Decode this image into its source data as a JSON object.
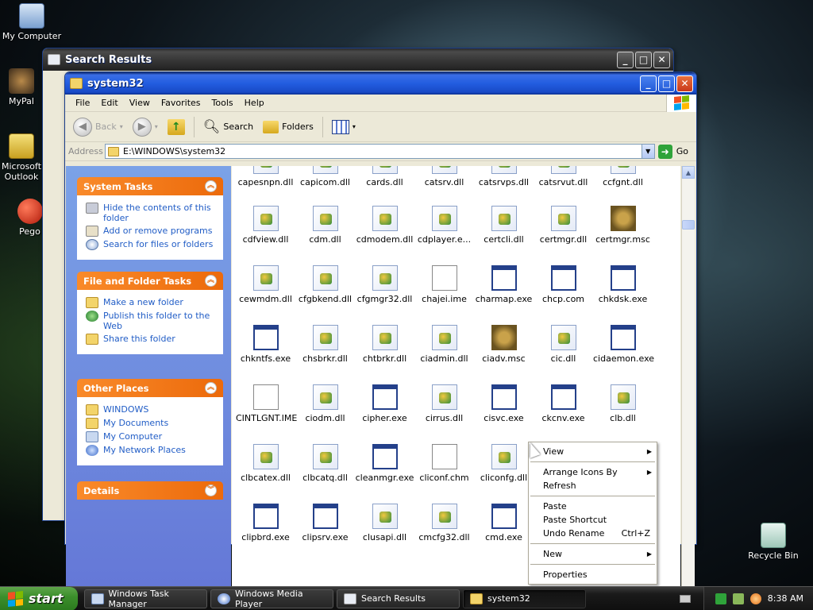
{
  "desktop": {
    "icons": [
      {
        "label": "My Computer"
      },
      {
        "label": "MyPal"
      },
      {
        "label": "Microsoft Outlook"
      },
      {
        "label": "Pego"
      },
      {
        "label": "Recycle Bin"
      }
    ]
  },
  "search_window": {
    "title": "Search Results"
  },
  "window": {
    "title": "system32",
    "menu": [
      "File",
      "Edit",
      "View",
      "Favorites",
      "Tools",
      "Help"
    ],
    "toolbar": {
      "back": "Back",
      "search": "Search",
      "folders": "Folders"
    },
    "address": {
      "label": "Address",
      "value": "E:\\WINDOWS\\system32",
      "go": "Go"
    }
  },
  "task_pane": {
    "system_tasks": {
      "title": "System Tasks",
      "items": [
        "Hide the contents of this folder",
        "Add or remove programs",
        "Search for files or folders"
      ]
    },
    "file_folder_tasks": {
      "title": "File and Folder Tasks",
      "items": [
        "Make a new folder",
        "Publish this folder to the Web",
        "Share this folder"
      ]
    },
    "other_places": {
      "title": "Other Places",
      "items": [
        "WINDOWS",
        "My Documents",
        "My Computer",
        "My Network Places"
      ]
    },
    "details": {
      "title": "Details"
    }
  },
  "files": [
    [
      "capesnpn.dll",
      "capicom.dll",
      "cards.dll",
      "catsrv.dll",
      "catsrvps.dll",
      "catsrvut.dll",
      "ccfgnt.dll"
    ],
    [
      "cdfview.dll",
      "cdm.dll",
      "cdmodem.dll",
      "cdplayer.e...",
      "certcli.dll",
      "certmgr.dll",
      "certmgr.msc"
    ],
    [
      "cewmdm.dll",
      "cfgbkend.dll",
      "cfgmgr32.dll",
      "chajei.ime",
      "charmap.exe",
      "chcp.com",
      "chkdsk.exe"
    ],
    [
      "chkntfs.exe",
      "chsbrkr.dll",
      "chtbrkr.dll",
      "ciadmin.dll",
      "ciadv.msc",
      "cic.dll",
      "cidaemon.exe"
    ],
    [
      "CINTLGNT.IME",
      "ciodm.dll",
      "cipher.exe",
      "cirrus.dll",
      "cisvc.exe",
      "ckcnv.exe",
      "clb.dll"
    ],
    [
      "clbcatex.dll",
      "clbcatq.dll",
      "cleanmgr.exe",
      "cliconf.chm",
      "cliconfg.dll"
    ],
    [
      "clipbrd.exe",
      "clipsrv.exe",
      "clusapi.dll",
      "cmcfg32.dll",
      "cmd.exe"
    ]
  ],
  "context_menu": {
    "view": "View",
    "arrange": "Arrange Icons By",
    "refresh": "Refresh",
    "paste": "Paste",
    "paste_shortcut": "Paste Shortcut",
    "undo": "Undo Rename",
    "undo_shortcut": "Ctrl+Z",
    "new": "New",
    "properties": "Properties"
  },
  "taskbar": {
    "start": "start",
    "tasks": [
      "Windows Task Manager",
      "Windows Media Player",
      "Search Results",
      "system32"
    ],
    "clock": "8:38 AM"
  },
  "colors": {
    "xp_blue": "#225de0",
    "task_link": "#215dc6",
    "start_green": "#3c8f2c",
    "dark_taskbar": "#1a1a1a"
  }
}
